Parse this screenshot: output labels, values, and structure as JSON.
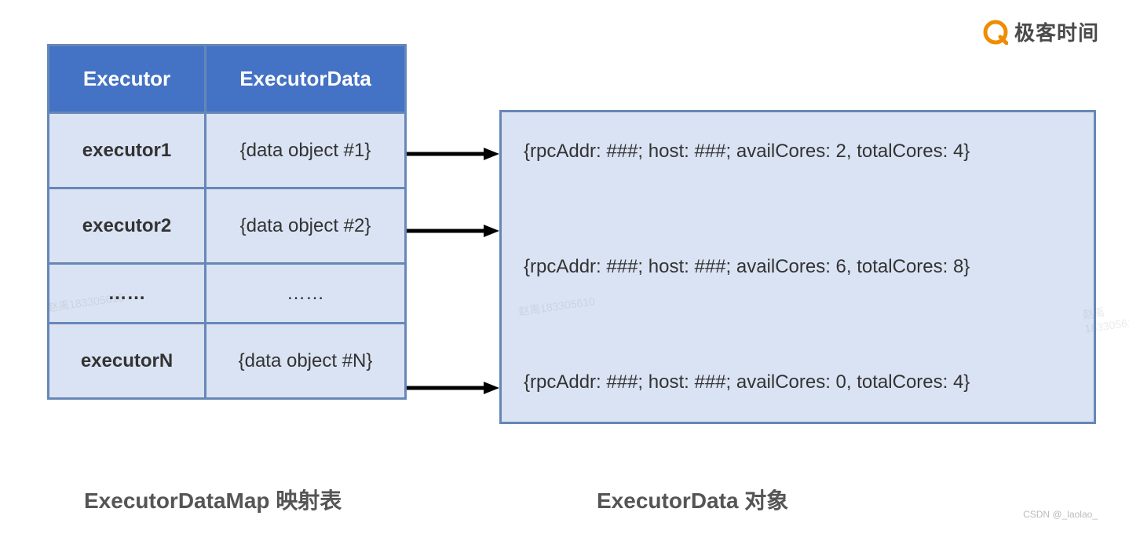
{
  "logo": {
    "text": "极客时间"
  },
  "table": {
    "headers": {
      "executor": "Executor",
      "data": "ExecutorData"
    },
    "rows": [
      {
        "executor": "executor1",
        "data": "{data object #1}"
      },
      {
        "executor": "executor2",
        "data": "{data object #2}"
      },
      {
        "executor": "……",
        "data": "……"
      },
      {
        "executor": "executorN",
        "data": "{data object #N}"
      }
    ]
  },
  "details": {
    "row1": "{rpcAddr: ###; host: ###; availCores: 2, totalCores: 4}",
    "row2": "{rpcAddr: ###; host: ###; availCores: 6, totalCores: 8}",
    "rowN": "{rpcAddr: ###; host: ###; availCores: 0, totalCores: 4}"
  },
  "captions": {
    "left": "ExecutorDataMap 映射表",
    "right": "ExecutorData 对象"
  },
  "credit": "CSDN @_laolao_",
  "watermark": "赵禹183305610",
  "chart_data": {
    "type": "table",
    "title": "ExecutorDataMap 映射表 → ExecutorData 对象",
    "columns": [
      "Executor",
      "ExecutorData",
      "rpcAddr",
      "host",
      "availCores",
      "totalCores"
    ],
    "rows": [
      [
        "executor1",
        "{data object #1}",
        "###",
        "###",
        2,
        4
      ],
      [
        "executor2",
        "{data object #2}",
        "###",
        "###",
        6,
        8
      ],
      [
        "executorN",
        "{data object #N}",
        "###",
        "###",
        0,
        4
      ]
    ]
  }
}
